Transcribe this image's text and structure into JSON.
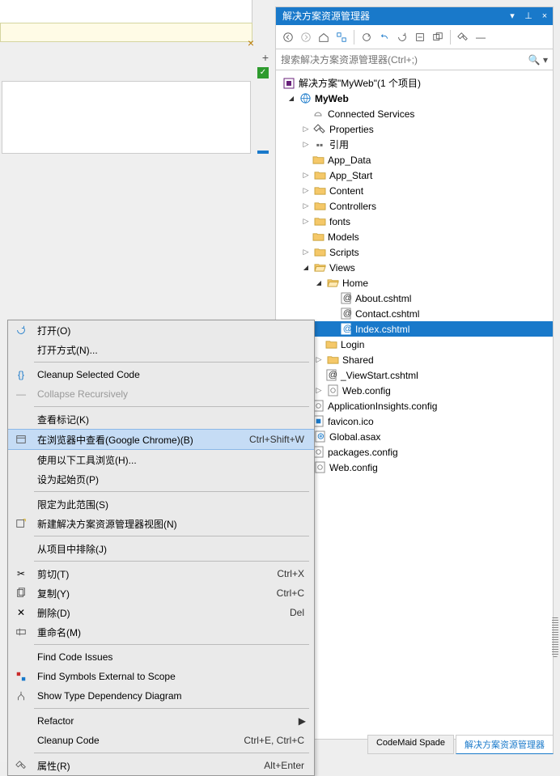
{
  "solutionExplorer": {
    "title": "解决方案资源管理器",
    "searchPlaceholder": "搜索解决方案资源管理器(Ctrl+;)",
    "solutionLabel": "解决方案\"MyWeb\"(1 个项目)",
    "project": "MyWeb",
    "nodes": {
      "connected": "Connected Services",
      "properties": "Properties",
      "references": "引用",
      "appdata": "App_Data",
      "appstart": "App_Start",
      "content": "Content",
      "controllers": "Controllers",
      "fonts": "fonts",
      "models": "Models",
      "scripts": "Scripts",
      "views": "Views",
      "home": "Home",
      "about": "About.cshtml",
      "contact": "Contact.cshtml",
      "index": "Index.cshtml",
      "login": "Login",
      "shared": "Shared",
      "viewstart": "_ViewStart.cshtml",
      "viewsWebconfig": "Web.config",
      "appInsights": "ApplicationInsights.config",
      "favicon": "favicon.ico",
      "globalasax": "Global.asax",
      "packages": "packages.config",
      "webconfig": "Web.config"
    }
  },
  "contextMenu": {
    "open": "打开(O)",
    "openWith": "打开方式(N)...",
    "cleanup": "Cleanup Selected Code",
    "collapse": "Collapse Recursively",
    "viewMarks": "查看标记(K)",
    "browse": "在浏览器中查看(Google Chrome)(B)",
    "browseShortcut": "Ctrl+Shift+W",
    "browseWith": "使用以下工具浏览(H)...",
    "setStart": "设为起始页(P)",
    "limitScope": "限定为此范围(S)",
    "newView": "新建解决方案资源管理器视图(N)",
    "exclude": "从项目中排除(J)",
    "cut": "剪切(T)",
    "cutShortcut": "Ctrl+X",
    "copy": "复制(Y)",
    "copyShortcut": "Ctrl+C",
    "delete": "删除(D)",
    "deleteShortcut": "Del",
    "rename": "重命名(M)",
    "findCode": "Find Code Issues",
    "findSymbols": "Find Symbols External to Scope",
    "showDiagram": "Show Type Dependency Diagram",
    "refactor": "Refactor",
    "cleanupCode": "Cleanup Code",
    "cleanupCodeShortcut": "Ctrl+E, Ctrl+C",
    "properties": "属性(R)",
    "propertiesShortcut": "Alt+Enter"
  },
  "bottomTabs": {
    "codemaid": "CodeMaid Spade",
    "solExp": "解决方案资源管理器"
  }
}
